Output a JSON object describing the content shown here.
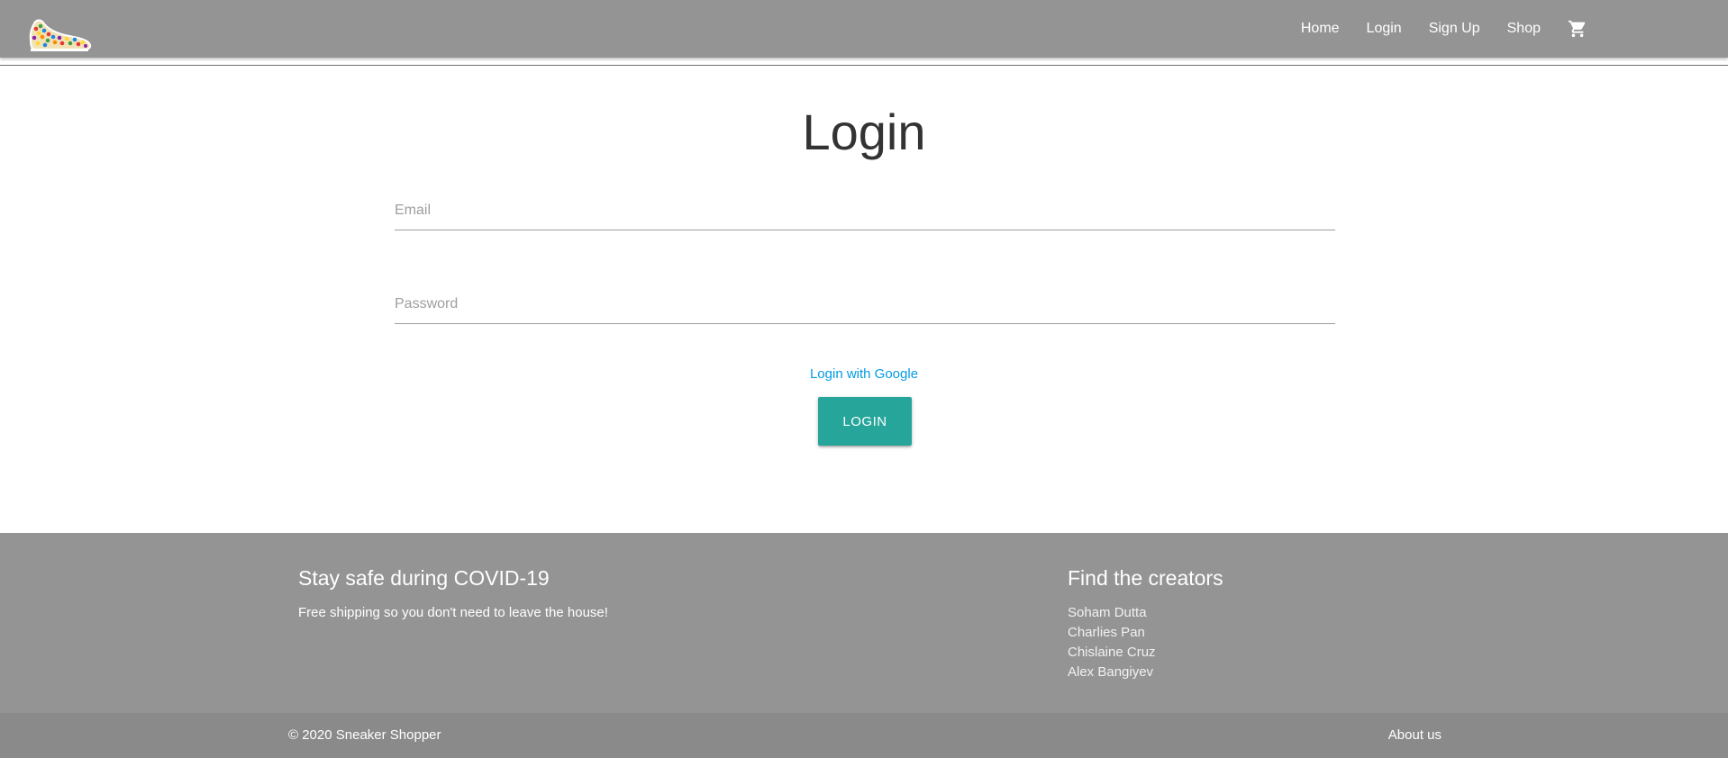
{
  "navbar": {
    "logo_name": "sneaker-logo",
    "links": [
      "Home",
      "Login",
      "Sign Up",
      "Shop"
    ],
    "cart_icon": "shopping-cart-icon"
  },
  "main": {
    "title": "Login",
    "email": {
      "placeholder": "Email",
      "value": ""
    },
    "password": {
      "placeholder": "Password",
      "value": ""
    },
    "google_link": "Login with Google",
    "login_button": "Login"
  },
  "footer": {
    "left_heading": "Stay safe during COVID-19",
    "left_text": "Free shipping so you don't need to leave the house!",
    "right_heading": "Find the creators",
    "creators": [
      "Soham Dutta",
      "Charlies Pan",
      "Chislaine Cruz",
      "Alex Bangiyev"
    ],
    "copyright": "© 2020 Sneaker Shopper",
    "about_link": "About us"
  },
  "colors": {
    "navbar_bg": "#949494",
    "footer_bg": "#949494",
    "button_bg": "#26a69a",
    "link": "#039be5"
  }
}
